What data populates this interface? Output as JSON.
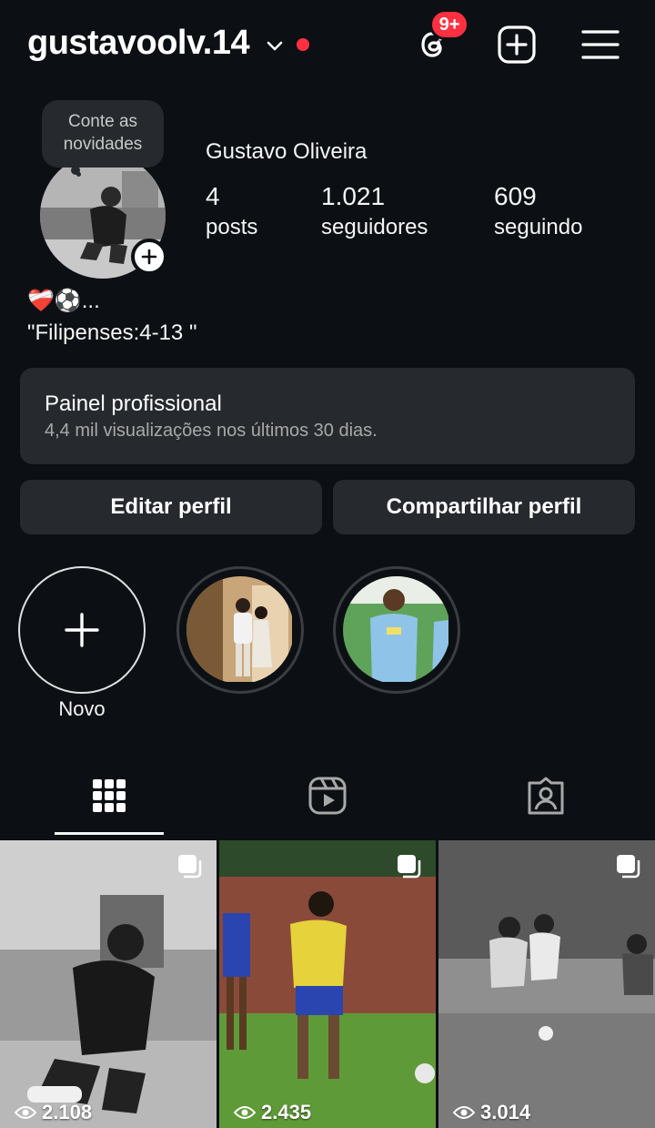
{
  "header": {
    "username": "gustavoolv.14",
    "threads_badge": "9+"
  },
  "profile": {
    "note": "Conte as novidades",
    "full_name": "Gustavo Oliveira",
    "stats": [
      {
        "value": "4",
        "label": "posts"
      },
      {
        "value": "1.021",
        "label": "seguidores"
      },
      {
        "value": "609",
        "label": "seguindo"
      }
    ],
    "bio_line1": "❤️‍🩹⚽...",
    "bio_line2": "\"Filipenses:4-13 \""
  },
  "dashboard": {
    "title": "Painel profissional",
    "subtitle": "4,4 mil visualizações nos últimos 30 dias."
  },
  "buttons": {
    "edit": "Editar perfil",
    "share": "Compartilhar perfil"
  },
  "highlights": {
    "new_label": "Novo"
  },
  "posts": [
    {
      "views": "2.108"
    },
    {
      "views": "2.435"
    },
    {
      "views": "3.014"
    }
  ],
  "colors": {
    "background": "#0c1014",
    "surface": "#262a2f",
    "accent_red": "#ff3040"
  }
}
